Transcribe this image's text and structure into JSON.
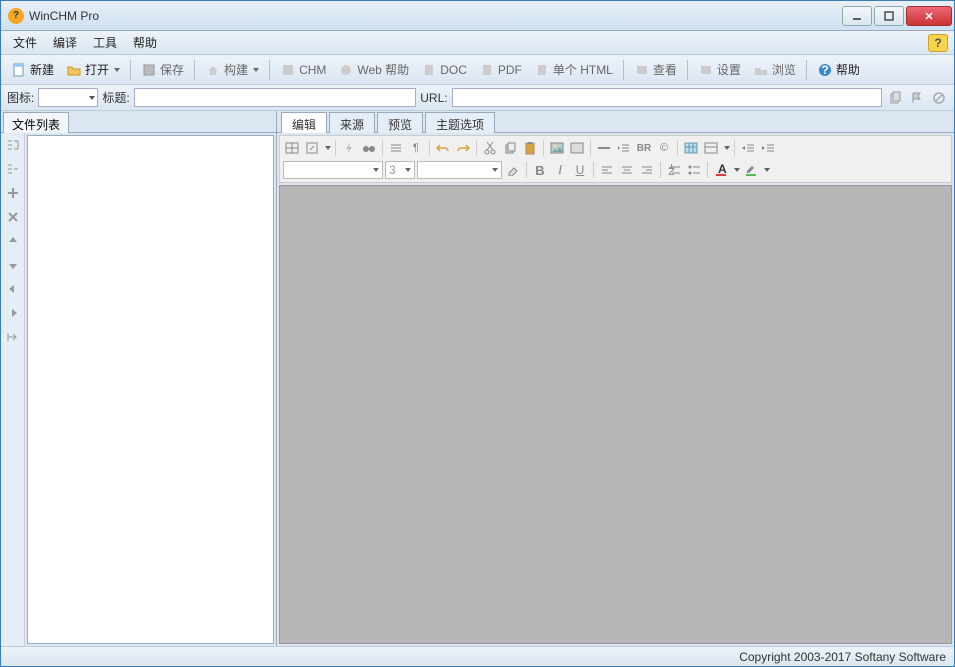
{
  "window": {
    "title": "WinCHM Pro"
  },
  "menu": {
    "file": "文件",
    "edit": "编译",
    "tools": "工具",
    "help": "帮助"
  },
  "toolbar": {
    "new": "新建",
    "open": "打开",
    "save": "保存",
    "build": "构建",
    "chm": "CHM",
    "webhelp": "Web 帮助",
    "doc": "DOC",
    "pdf": "PDF",
    "singlehtml": "单个 HTML",
    "view": "查看",
    "settings": "设置",
    "browse": "浏览",
    "help": "帮助"
  },
  "propbar": {
    "icon_label": "图标:",
    "title_label": "标题:",
    "title_placeholder": "",
    "url_label": "URL:",
    "url_placeholder": ""
  },
  "left": {
    "tab": "文件列表"
  },
  "right": {
    "tabs": {
      "edit": "编辑",
      "source": "来源",
      "preview": "预览",
      "theme": "主题选项"
    },
    "fontsize": "3",
    "br_label": "BR"
  },
  "status": {
    "copyright": "Copyright 2003-2017 Softany Software"
  }
}
